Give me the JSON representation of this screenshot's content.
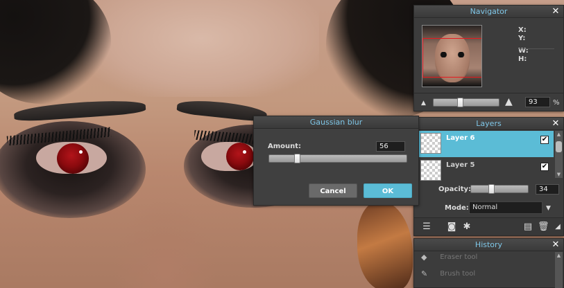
{
  "navigator": {
    "title": "Navigator",
    "close": "✕",
    "x_label": "X:",
    "y_label": "Y:",
    "w_label": "W:",
    "h_label": "H:",
    "zoom_value": "93",
    "zoom_unit": "%",
    "zoom_level": 0.4
  },
  "layers": {
    "title": "Layers",
    "close": "✕",
    "items": [
      {
        "name": "Layer 6",
        "visible": "✔",
        "selected": true
      },
      {
        "name": "Layer 5",
        "visible": "✔",
        "selected": false
      }
    ],
    "opacity_label": "Opacity:",
    "opacity_value": "34",
    "opacity_level": 0.34,
    "mode_label": "Mode:",
    "mode_value": "Normal"
  },
  "history": {
    "title": "History",
    "close": "✕",
    "items": [
      {
        "label": "Eraser tool",
        "icon": "eraser-icon"
      },
      {
        "label": "Brush tool",
        "icon": "brush-icon"
      }
    ]
  },
  "gaussian_blur": {
    "title": "Gaussian blur",
    "amount_label": "Amount:",
    "amount_value": "56",
    "amount_level": 0.19,
    "cancel_label": "Cancel",
    "ok_label": "OK"
  }
}
